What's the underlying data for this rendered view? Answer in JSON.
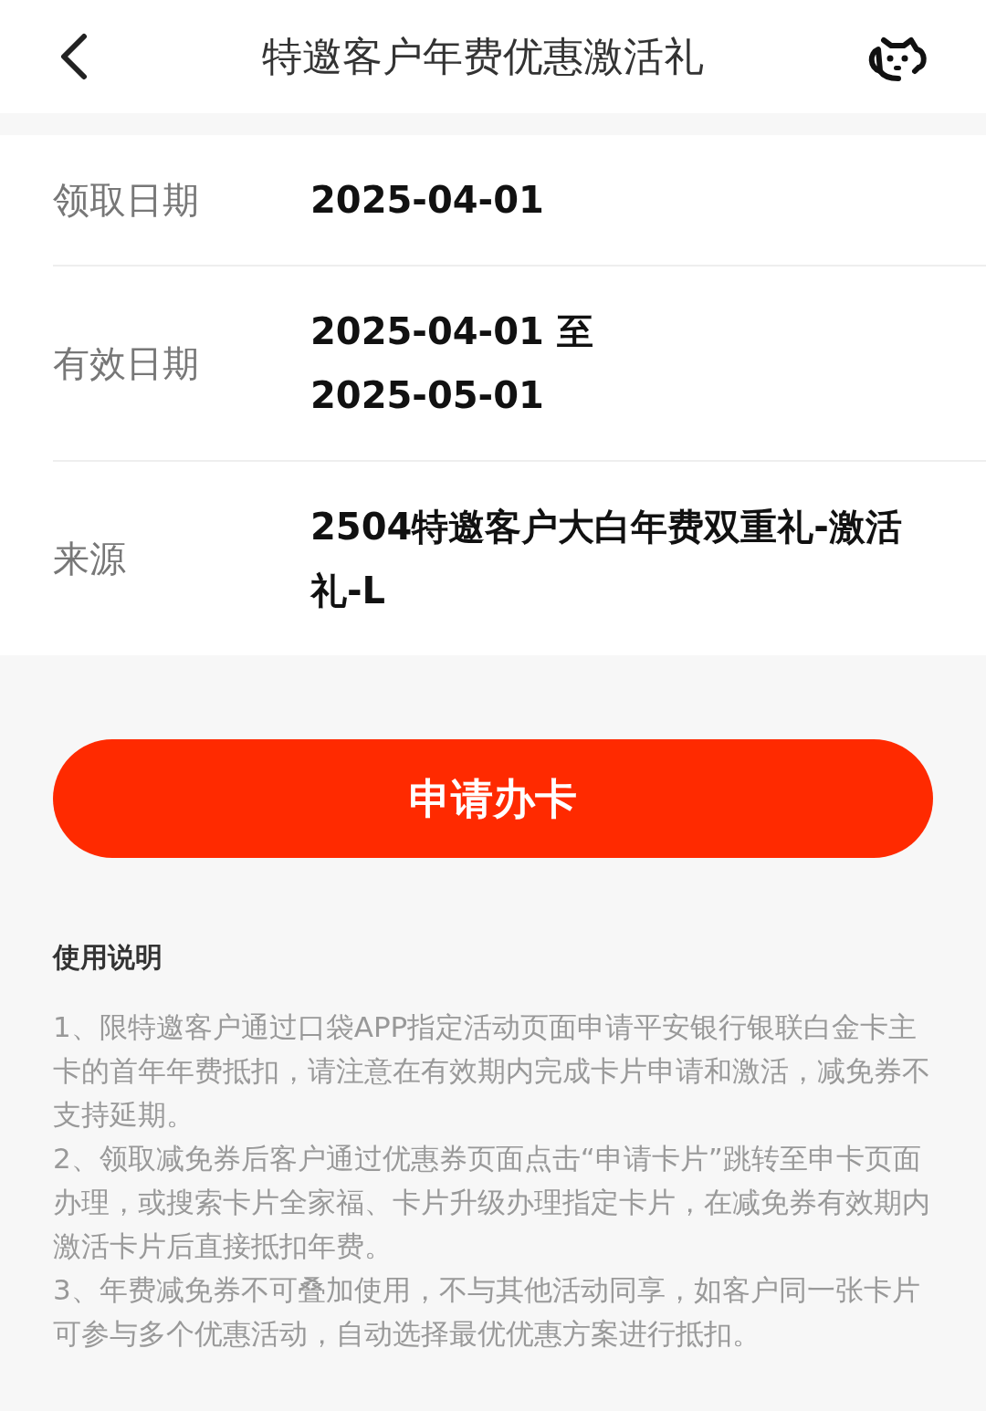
{
  "header": {
    "title": "特邀客户年费优惠激活礼"
  },
  "details": [
    {
      "label": "领取日期",
      "value": "2025-04-01"
    },
    {
      "label": "有效日期",
      "value": "2025-04-01 至\n2025-05-01"
    },
    {
      "label": "来源",
      "value": "2504特邀客户大白年费双重礼-激活礼-L"
    }
  ],
  "apply_button": "申请办卡",
  "usage": {
    "title": "使用说明",
    "notes": [
      "1、限特邀客户通过口袋APP指定活动页面申请平安银行银联白金卡主卡的首年年费抵扣，请注意在有效期内完成卡片申请和激活，减免券不支持延期。",
      "2、领取减免券后客户通过优惠券页面点击“申请卡片”跳转至申卡页面办理，或搜索卡片全家福、卡片升级办理指定卡片，在减免券有效期内激活卡片后直接抵扣年费。",
      "3、年费减免券不可叠加使用，不与其他活动同享，如客户同一张卡片可参与多个优惠活动，自动选择最优优惠方案进行抵扣。"
    ]
  }
}
